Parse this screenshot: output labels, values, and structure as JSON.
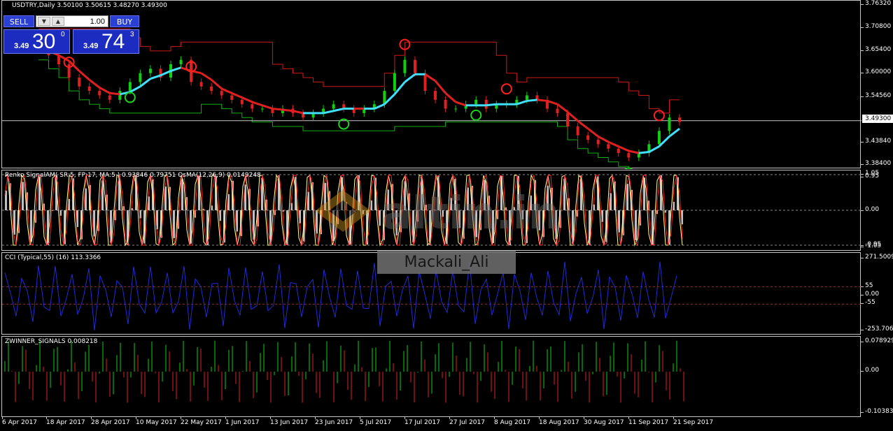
{
  "main": {
    "title": "USDTRY,Daily  3.50100 3.50615 3.48270 3.49300",
    "price_axis": [
      "3.76320",
      "3.70800",
      "3.65400",
      "3.60000",
      "3.54560",
      "3.49300",
      "3.43840",
      "3.38400"
    ],
    "current_price": "3.49300"
  },
  "trade_panel": {
    "sell_label": "SELL",
    "buy_label": "BUY",
    "lot_value": "1.00",
    "sell_small": "3.49",
    "sell_big": "30",
    "sell_sup": "0",
    "buy_small": "3.49",
    "buy_big": "74",
    "buy_sup": "3"
  },
  "renko": {
    "label": "Renko SignalAM( SR:5, FP:17, MA:5 ) 0.93846 0.79751  OsMA(12,26,9) 0.0149248",
    "axis": [
      "1.05",
      "0.95",
      "0.00",
      "-0.95",
      "-1.05"
    ]
  },
  "cci": {
    "label": "CCI (Typical,55) (16) 113.3366",
    "axis": [
      "271.5009",
      "55",
      "0.00",
      "-55",
      "-253.7067"
    ]
  },
  "zwinner": {
    "label": "ZWINNER_SIGNALS 0.008218",
    "axis": [
      "0.078929",
      "0.00",
      "-0.103838"
    ]
  },
  "dates": [
    "6 Apr 2017",
    "18 Apr 2017",
    "28 Apr 2017",
    "10 May 2017",
    "22 May 2017",
    "1 Jun 2017",
    "13 Jun 2017",
    "23 Jun 2017",
    "5 Jul 2017",
    "17 Jul 2017",
    "27 Jul 2017",
    "8 Aug 2017",
    "18 Aug 2017",
    "30 Aug 2017",
    "11 Sep 2017",
    "21 Sep 2017"
  ],
  "watermark": {
    "text": "altin.in"
  },
  "overlay_label": "Mackali_Ali",
  "colors": {
    "bull": "#10d010",
    "bear": "#e02020",
    "up_band": "#d01818",
    "down_band": "#10b010",
    "fast_ma": "#40e0ff",
    "sell_btn": "#2a3fd3",
    "cci_line": "#1e2cd8"
  },
  "chart_data": [
    {
      "type": "candlestick",
      "symbol": "USDTRY",
      "timeframe": "Daily",
      "ohlc_last": {
        "open": 3.501,
        "high": 3.50615,
        "low": 3.4827,
        "close": 3.493
      },
      "ylim": [
        3.384,
        3.7632
      ],
      "close_approx": [
        3.66,
        3.64,
        3.62,
        3.59,
        3.57,
        3.56,
        3.55,
        3.54,
        3.56,
        3.58,
        3.6,
        3.61,
        3.59,
        3.62,
        3.63,
        3.58,
        3.57,
        3.56,
        3.55,
        3.54,
        3.53,
        3.52,
        3.52,
        3.51,
        3.52,
        3.51,
        3.5,
        3.51,
        3.52,
        3.53,
        3.52,
        3.51,
        3.52,
        3.53,
        3.56,
        3.6,
        3.63,
        3.6,
        3.56,
        3.54,
        3.52,
        3.52,
        3.53,
        3.54,
        3.52,
        3.53,
        3.53,
        3.54,
        3.55,
        3.54,
        3.52,
        3.51,
        3.48,
        3.46,
        3.45,
        3.44,
        3.43,
        3.42,
        3.41,
        3.42,
        3.44,
        3.47,
        3.5,
        3.49
      ]
    },
    {
      "type": "histogram",
      "name": "Renko SignalAM",
      "ylim": [
        -1.05,
        1.05
      ]
    },
    {
      "type": "line",
      "name": "CCI (Typical,55)",
      "ylim": [
        -253.7067,
        271.5009
      ],
      "levels": [
        55,
        -55
      ]
    },
    {
      "type": "histogram",
      "name": "ZWINNER_SIGNALS",
      "ylim": [
        -0.103838,
        0.078929
      ]
    }
  ]
}
